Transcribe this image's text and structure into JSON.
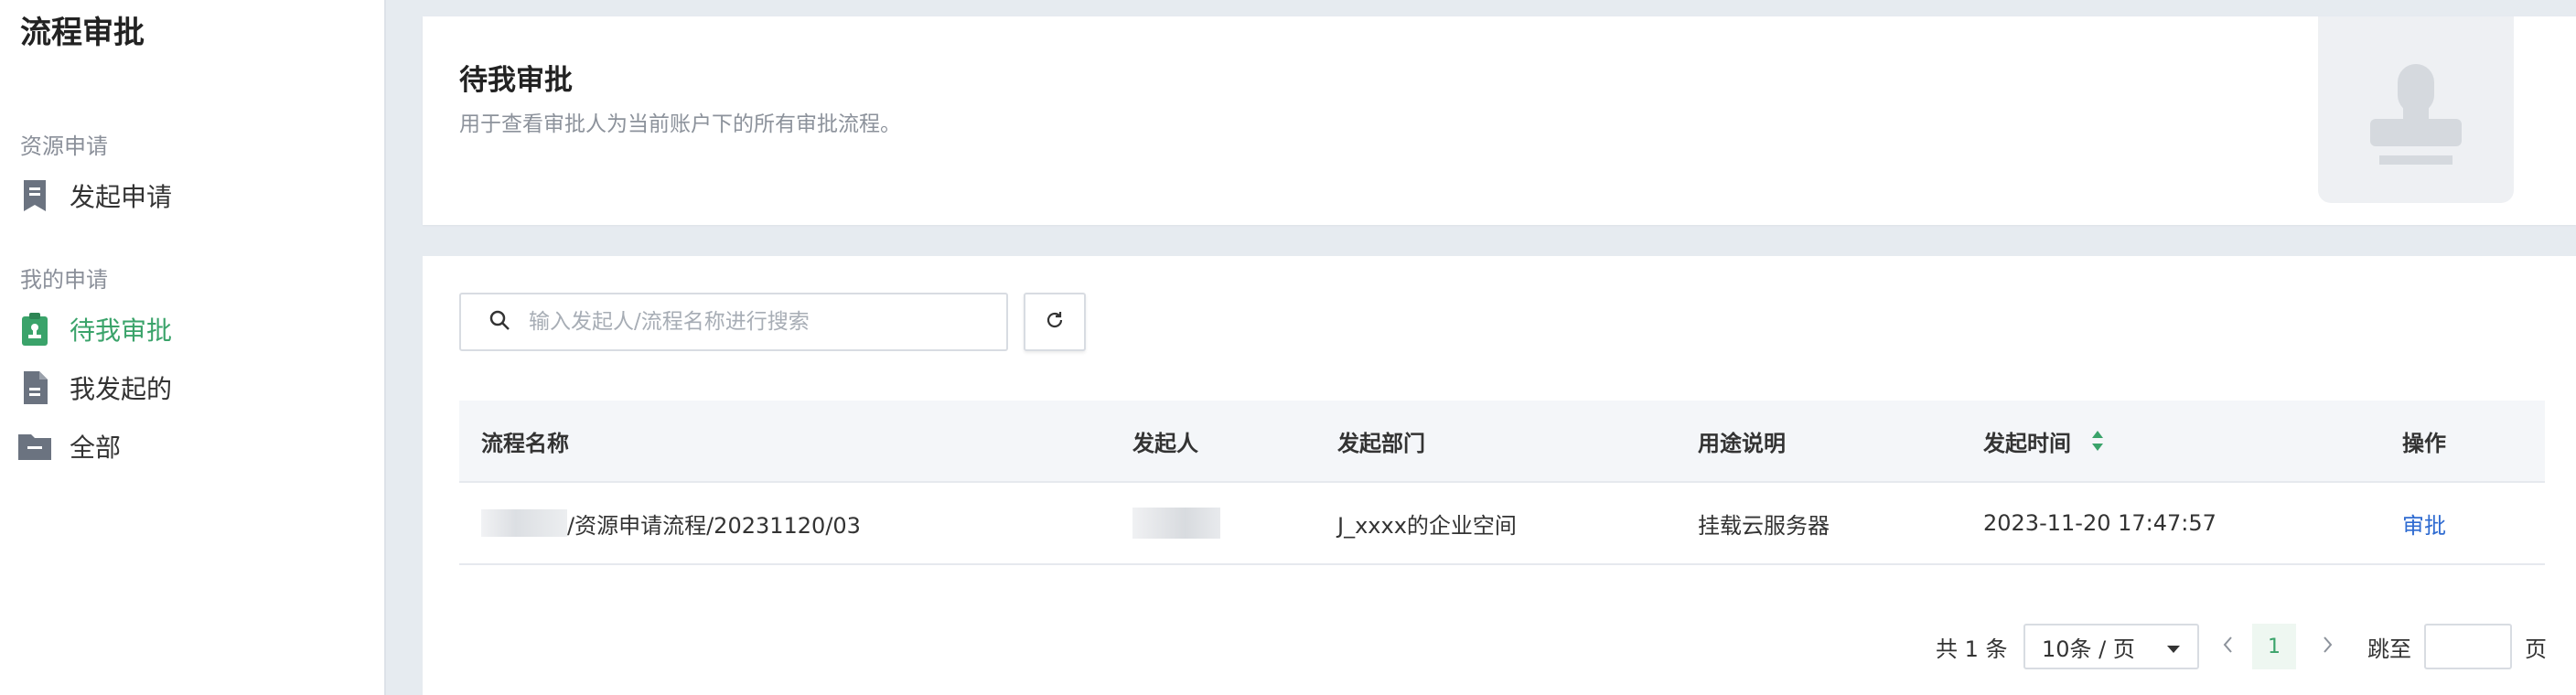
{
  "sidebar": {
    "title": "流程审批",
    "groups": [
      {
        "label": "资源申请",
        "items": [
          {
            "label": "发起申请",
            "icon": "bookmark-doc-icon"
          }
        ]
      },
      {
        "label": "我的申请",
        "items": [
          {
            "label": "待我审批",
            "icon": "stamp-clipboard-icon",
            "active": true
          },
          {
            "label": "我发起的",
            "icon": "document-icon"
          },
          {
            "label": "全部",
            "icon": "folder-icon"
          }
        ]
      }
    ]
  },
  "header": {
    "title": "待我审批",
    "description": "用于查看审批人为当前账户下的所有审批流程。",
    "illustration": "stamp-illustration-icon"
  },
  "toolbar": {
    "search_placeholder": "输入发起人/流程名称进行搜索",
    "search_icon": "search-icon",
    "refresh_icon": "refresh-icon"
  },
  "table": {
    "columns": [
      "流程名称",
      "发起人",
      "发起部门",
      "用途说明",
      "发起时间",
      "操作"
    ],
    "rows": [
      {
        "name_suffix": "/资源申请流程/20231120/03",
        "department": "J_xxxx的企业空间",
        "purpose": "挂载云服务器",
        "time": "2023-11-20 17:47:57",
        "action": "审批"
      }
    ]
  },
  "pagination": {
    "total": "共 1 条",
    "page_size": "10条 / 页",
    "current_page": "1",
    "jump_label": "跳至",
    "page_label": "页"
  },
  "colors": {
    "accent_green": "#3aa36a",
    "link_blue": "#2f6bd1",
    "background": "#e6ebf0"
  }
}
